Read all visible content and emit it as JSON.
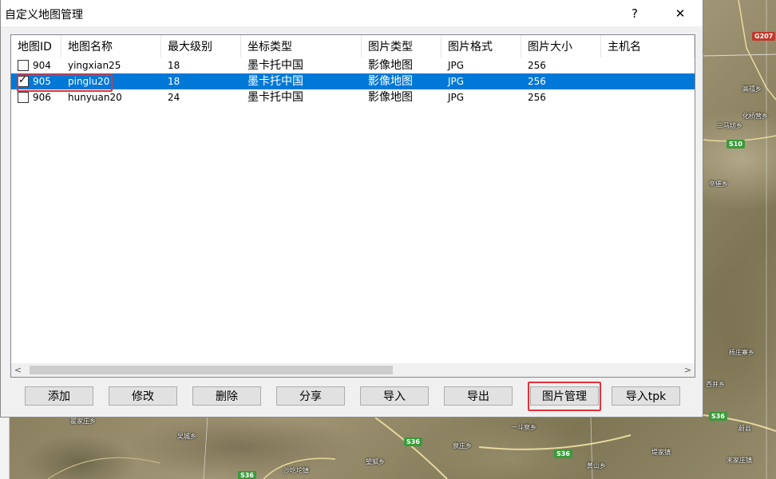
{
  "window": {
    "title": "自定义地图管理",
    "help_label": "?",
    "close_label": "✕"
  },
  "columns": [
    "地图ID",
    "地图名称",
    "最大级别",
    "坐标类型",
    "图片类型",
    "图片格式",
    "图片大小",
    "主机名"
  ],
  "rows": [
    {
      "id": "904",
      "name": "yingxian25",
      "max_level": "18",
      "coord_type": "墨卡托中国",
      "image_type": "影像地图",
      "image_format": "JPG",
      "image_size": "256",
      "host": "",
      "checked": false,
      "selected": false
    },
    {
      "id": "905",
      "name": "pinglu20",
      "max_level": "18",
      "coord_type": "墨卡托中国",
      "image_type": "影像地图",
      "image_format": "JPG",
      "image_size": "256",
      "host": "",
      "checked": true,
      "selected": true
    },
    {
      "id": "906",
      "name": "hunyuan20",
      "max_level": "24",
      "coord_type": "墨卡托中国",
      "image_type": "影像地图",
      "image_format": "JPG",
      "image_size": "256",
      "host": "",
      "checked": false,
      "selected": false
    }
  ],
  "scrollbar": {
    "left_arrow": "<",
    "right_arrow": ">"
  },
  "buttons": [
    "添加",
    "修改",
    "删除",
    "分享",
    "导入",
    "导出",
    "图片管理",
    "导入tpk"
  ],
  "map": {
    "labels": [
      "高禧乡",
      "化桥营乡",
      "三马坊乡",
      "辛堡乡",
      "杨庄寨乡",
      "西井乡",
      "翟家庄乡",
      "吴城乡",
      "沙圪坨镇",
      "望狐乡",
      "泉庄乡",
      "一斗泉乡",
      "黄山乡",
      "堤家镇",
      "末家庄镇",
      "蔚县"
    ],
    "shields": [
      "G207",
      "S10",
      "S36",
      "S36",
      "S36",
      "S36"
    ]
  },
  "colors": {
    "selection": "#0078d7",
    "highlight_box": "#e0333a"
  }
}
